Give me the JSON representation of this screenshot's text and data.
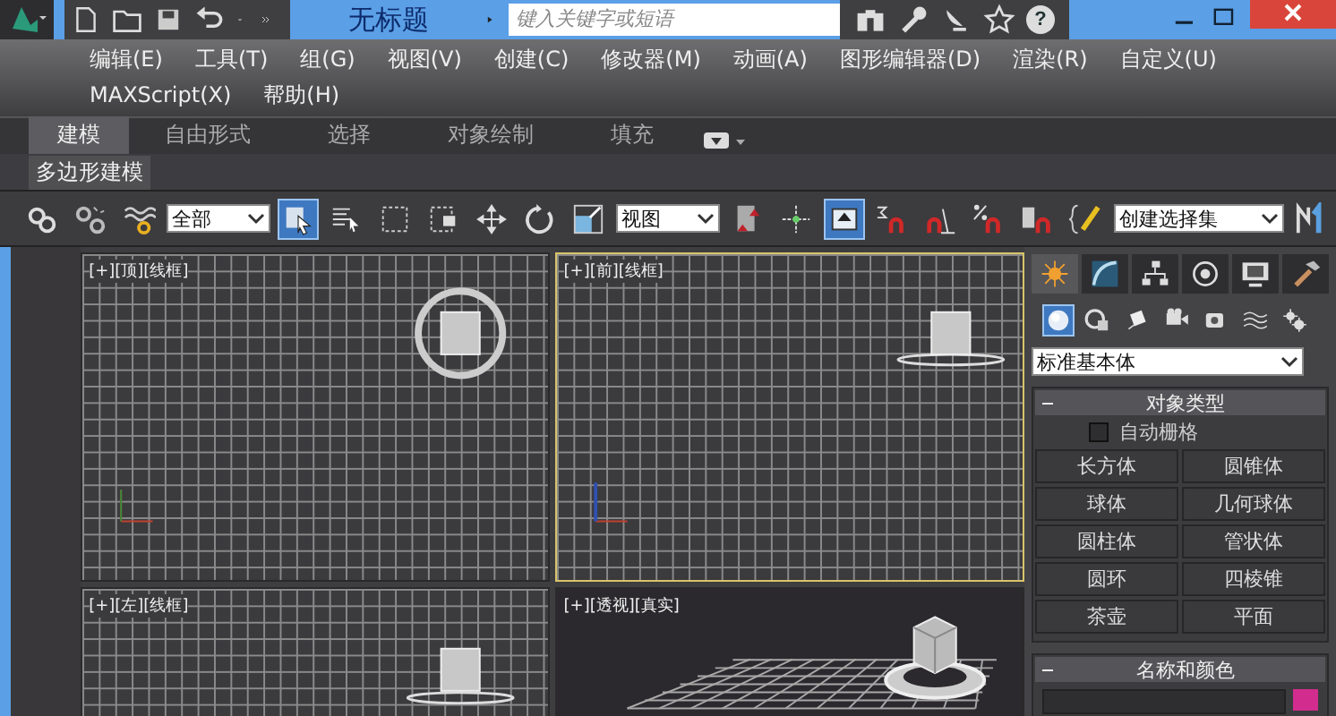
{
  "title_bar": {
    "title": "无标题",
    "search": {
      "placeholder": "键入关键字或短语"
    },
    "help": "?"
  },
  "menu": {
    "items": [
      "编辑(E)",
      "工具(T)",
      "组(G)",
      "视图(V)",
      "创建(C)",
      "修改器(M)",
      "动画(A)",
      "图形编辑器(D)",
      "渲染(R)",
      "自定义(U)",
      "MAXScript(X)",
      "帮助(H)"
    ]
  },
  "ribbon": {
    "tabs": [
      {
        "label": "建模",
        "selected": true
      },
      {
        "label": "自由形式",
        "selected": false
      },
      {
        "label": "选择",
        "selected": false
      },
      {
        "label": "对象绘制",
        "selected": false
      },
      {
        "label": "填充",
        "selected": false
      }
    ],
    "panel": "多边形建模"
  },
  "toolbar": {
    "items": [
      {
        "kind": "button",
        "selected": false
      },
      {
        "kind": "button",
        "selected": false
      },
      {
        "kind": "button",
        "selected": false
      },
      {
        "kind": "dropdown",
        "value": "全部"
      },
      {
        "kind": "button",
        "selected": true
      },
      {
        "kind": "button",
        "selected": false
      },
      {
        "kind": "button",
        "selected": false
      },
      {
        "kind": "button",
        "selected": false
      },
      {
        "kind": "button",
        "selected": false
      },
      {
        "kind": "button",
        "selected": false
      },
      {
        "kind": "button",
        "selected": false
      },
      {
        "kind": "dropdown",
        "value": "视图"
      },
      {
        "kind": "button",
        "selected": false
      },
      {
        "kind": "button",
        "selected": false
      },
      {
        "kind": "button",
        "selected": true
      },
      {
        "kind": "button",
        "selected": false
      },
      {
        "kind": "button",
        "selected": false
      },
      {
        "kind": "button",
        "selected": false
      },
      {
        "kind": "button",
        "selected": false
      },
      {
        "kind": "button",
        "selected": false
      },
      {
        "kind": "dropdown",
        "value": "创建选择集"
      },
      {
        "kind": "button",
        "selected": false
      }
    ]
  },
  "viewports": [
    {
      "label": "[+][顶][线框]",
      "kind": "top",
      "active": false
    },
    {
      "label": "[+][前][线框]",
      "kind": "front",
      "active": true
    },
    {
      "label": "[+][左][线框]",
      "kind": "left",
      "active": false
    },
    {
      "label": "[+][透视][真实]",
      "kind": "perspective",
      "active": false
    }
  ],
  "command_panel": {
    "tabs": [
      {
        "selected": true
      },
      {
        "selected": false
      },
      {
        "selected": false
      },
      {
        "selected": false
      },
      {
        "selected": false
      },
      {
        "selected": false
      }
    ],
    "categories": [
      {
        "selected": true
      },
      {
        "selected": false
      },
      {
        "selected": false
      },
      {
        "selected": false
      },
      {
        "selected": false
      },
      {
        "selected": false
      },
      {
        "selected": false
      }
    ],
    "dropdown": "标准基本体",
    "object_type": {
      "title": "对象类型",
      "autogrid": {
        "label": "自动栅格",
        "checked": false
      },
      "buttons": [
        "长方体",
        "圆锥体",
        "球体",
        "几何球体",
        "圆柱体",
        "管状体",
        "圆环",
        "四棱锥",
        "茶壶",
        "平面"
      ]
    },
    "name_color": {
      "title": "名称和颜色",
      "color": "#d22c8e"
    }
  }
}
